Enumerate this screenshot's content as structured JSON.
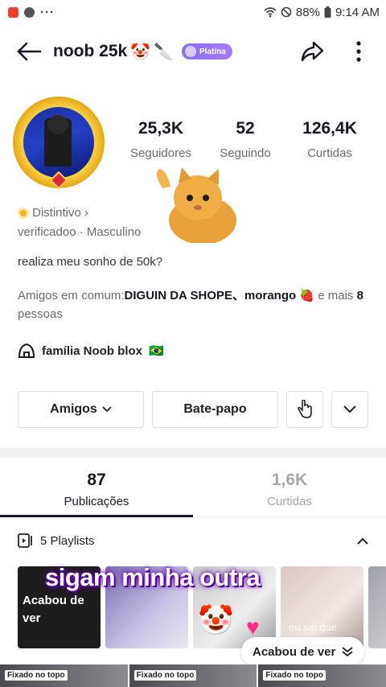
{
  "status_bar": {
    "battery": "88%",
    "time": "9:14 AM"
  },
  "header": {
    "username": "noob 25k",
    "badge": "Platina"
  },
  "stats": [
    {
      "value": "25,3K",
      "label": "Seguidores"
    },
    {
      "value": "52",
      "label": "Seguindo"
    },
    {
      "value": "126,4K",
      "label": "Curtidas"
    }
  ],
  "profile": {
    "badge_label": "Distintivo",
    "badge_chevron": "›",
    "meta": "verificadoo · Masculino",
    "bio": "realiza meu sonho de 50k?",
    "mutual_prefix": "Amigos em comum:",
    "mutual_names": "DIGUIN DA SHOPE、morango",
    "mutual_mid": "e mais",
    "mutual_count": "8",
    "mutual_suffix": "pessoas",
    "family": "família Noob blox"
  },
  "actions": {
    "friends": "Amigos",
    "chat": "Bate-papo"
  },
  "tabs": [
    {
      "count": "87",
      "label": "Publicações"
    },
    {
      "count": "1,6K",
      "label": "Curtidas"
    }
  ],
  "playlists": {
    "title": "5 Playlists",
    "thumb1_text": "Acabou de ver",
    "thumb4_text": "eu sei que"
  },
  "overlay": {
    "caption": "sigam minha outra"
  },
  "watched_pill": "Acabou de ver",
  "pinned_label": "Fixado no topo"
}
